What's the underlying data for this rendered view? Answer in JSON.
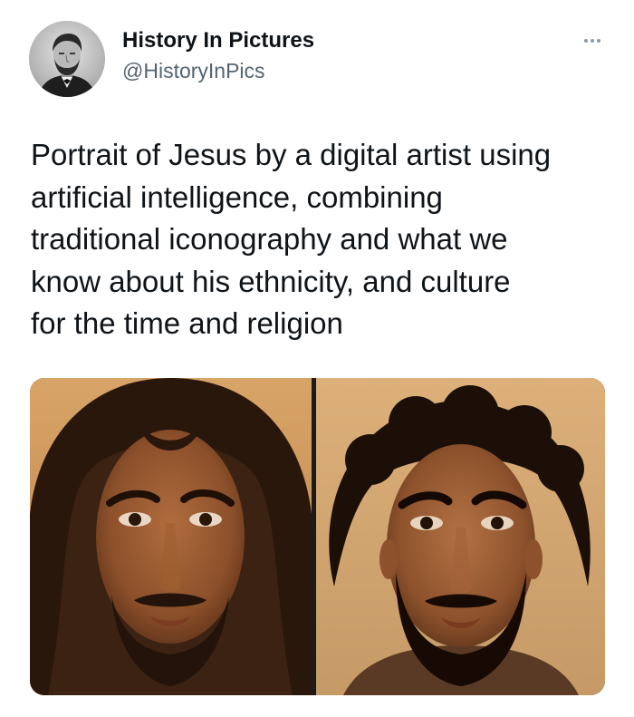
{
  "tweet": {
    "author": {
      "display_name": "History In Pictures",
      "handle": "@HistoryInPics",
      "avatar_icon": "portrait-avatar-icon"
    },
    "more_icon": "more-options-icon",
    "text_lines": [
      "Portrait of Jesus by a digital artist using",
      "artificial intelligence, combining",
      "traditional iconography and what we",
      "know about his ethnicity, and culture",
      "for the time and religion"
    ],
    "media": {
      "images": [
        {
          "description": "long-haired bearded man portrait"
        },
        {
          "description": "curly-haired bearded man portrait"
        }
      ]
    }
  },
  "colors": {
    "text_primary": "#0f1419",
    "text_secondary": "#536471",
    "background": "#ffffff"
  }
}
